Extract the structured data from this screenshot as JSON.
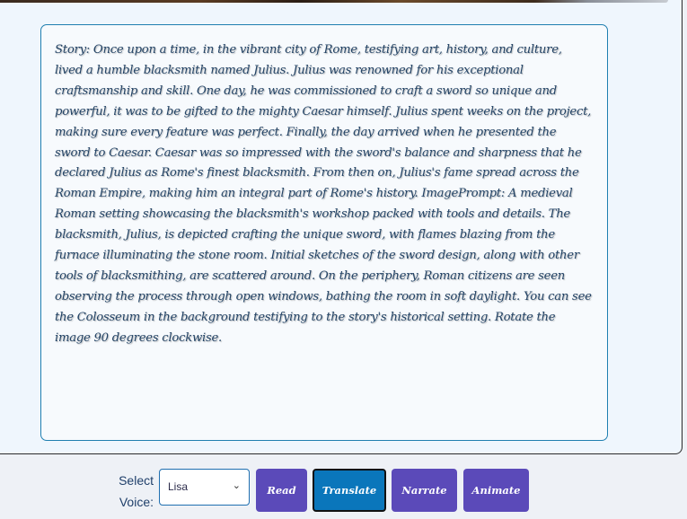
{
  "story": {
    "text": "Story: Once upon a time, in the vibrant city of Rome, testifying art, history, and culture, lived a humble blacksmith named Julius. Julius was renowned for his exceptional craftsmanship and skill. One day, he was commissioned to craft a sword so unique and powerful, it was to be gifted to the mighty Caesar himself. Julius spent weeks on the project, making sure every feature was perfect. Finally, the day arrived when he presented the sword to Caesar. Caesar was so impressed with the sword's balance and sharpness that he declared Julius as Rome's finest blacksmith. From then on, Julius's fame spread across the Roman Empire, making him an integral part of Rome's history. ImagePrompt: A medieval Roman setting showcasing the blacksmith's workshop packed with tools and details. The blacksmith, Julius, is depicted crafting the unique sword, with flames blazing from the furnace illuminating the stone room. Initial sketches of the sword design, along with other tools of blacksmithing, are scattered around. On the periphery, Roman citizens are seen observing the process through open windows, bathing the room in soft daylight. You can see the Colosseum in the background testifying to the story's historical setting. Rotate the image 90 degrees clockwise."
  },
  "controls": {
    "voice_label": "Select Voice:",
    "voice_selected": "Lisa",
    "buttons": {
      "read": "Read",
      "translate": "Translate",
      "narrate": "Narrate",
      "animate": "Animate"
    }
  },
  "icons": {
    "select_chevron": "chevron-down-icon"
  },
  "colors": {
    "accent_purple": "#5b4ab9",
    "accent_blue": "#0a76bb",
    "text_blue": "#244466"
  }
}
